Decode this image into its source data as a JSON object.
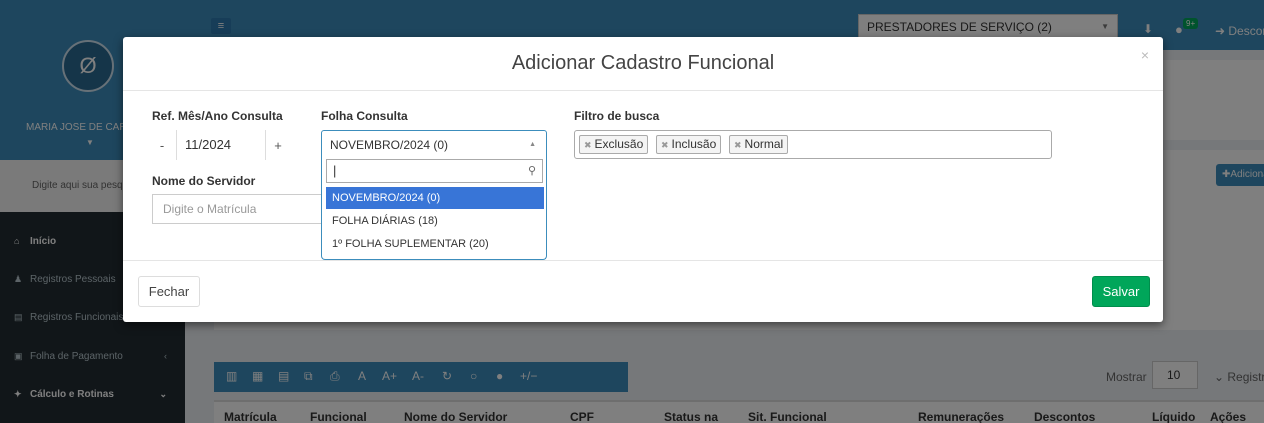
{
  "sidebar": {
    "user_name": "MARIA JOSE DE CARVALHO",
    "search_placeholder": "Digite aqui sua pesquisa",
    "menu": [
      {
        "label": "Início",
        "icon": "home-icon",
        "active": true
      },
      {
        "label": "Registros Pessoais",
        "icon": "user-icon"
      },
      {
        "label": "Registros Funcionais",
        "icon": "id-card-icon"
      },
      {
        "label": "Folha de Pagamento",
        "icon": "money-icon"
      },
      {
        "label": "Cálculo e Rotinas",
        "icon": "gear-icon",
        "active": true
      }
    ]
  },
  "topbar": {
    "company_select": "PRESTADORES DE SERVIÇO (2)",
    "notification_count": "9+",
    "logout_label": "Desconectar"
  },
  "page": {
    "add_button_label": "Adicionar",
    "show_label": "Mostrar",
    "page_size": "10",
    "records_label": "Registros",
    "table_columns": [
      "Matrícula",
      "Funcional",
      "Nome do Servidor",
      "CPF",
      "Status na",
      "Sit. Funcional",
      "Remunerações",
      "Descontos",
      "Líquido",
      "Ações"
    ],
    "toolbar_icons": [
      "pdf-icon",
      "excel-icon",
      "csv-icon",
      "copy-icon",
      "print-icon",
      "font-icon",
      "font-increase-icon",
      "font-decrease-icon",
      "refresh-icon",
      "circle-outline-icon",
      "circle-filled-icon",
      "columns-toggle-icon"
    ],
    "toolbar_labels": [
      "A",
      "A+",
      "A-",
      "+/−"
    ]
  },
  "modal": {
    "title": "Adicionar Cadastro Funcional",
    "ref_label": "Ref. Mês/Ano Consulta",
    "ref_value": "11/2024",
    "minus": "-",
    "plus": "+",
    "folha_label": "Folha Consulta",
    "folha_value": "NOVEMBRO/2024 (0)",
    "folha_options": [
      "NOVEMBRO/2024 (0)",
      "FOLHA DIÁRIAS (18)",
      "1º FOLHA SUPLEMENTAR (20)"
    ],
    "filtro_label": "Filtro de busca",
    "filtro_tags": [
      "Exclusão",
      "Inclusão",
      "Normal"
    ],
    "servidor_label": "Nome do Servidor",
    "servidor_placeholder": "Digite o Matrícula",
    "close_label": "Fechar",
    "save_label": "Salvar"
  }
}
